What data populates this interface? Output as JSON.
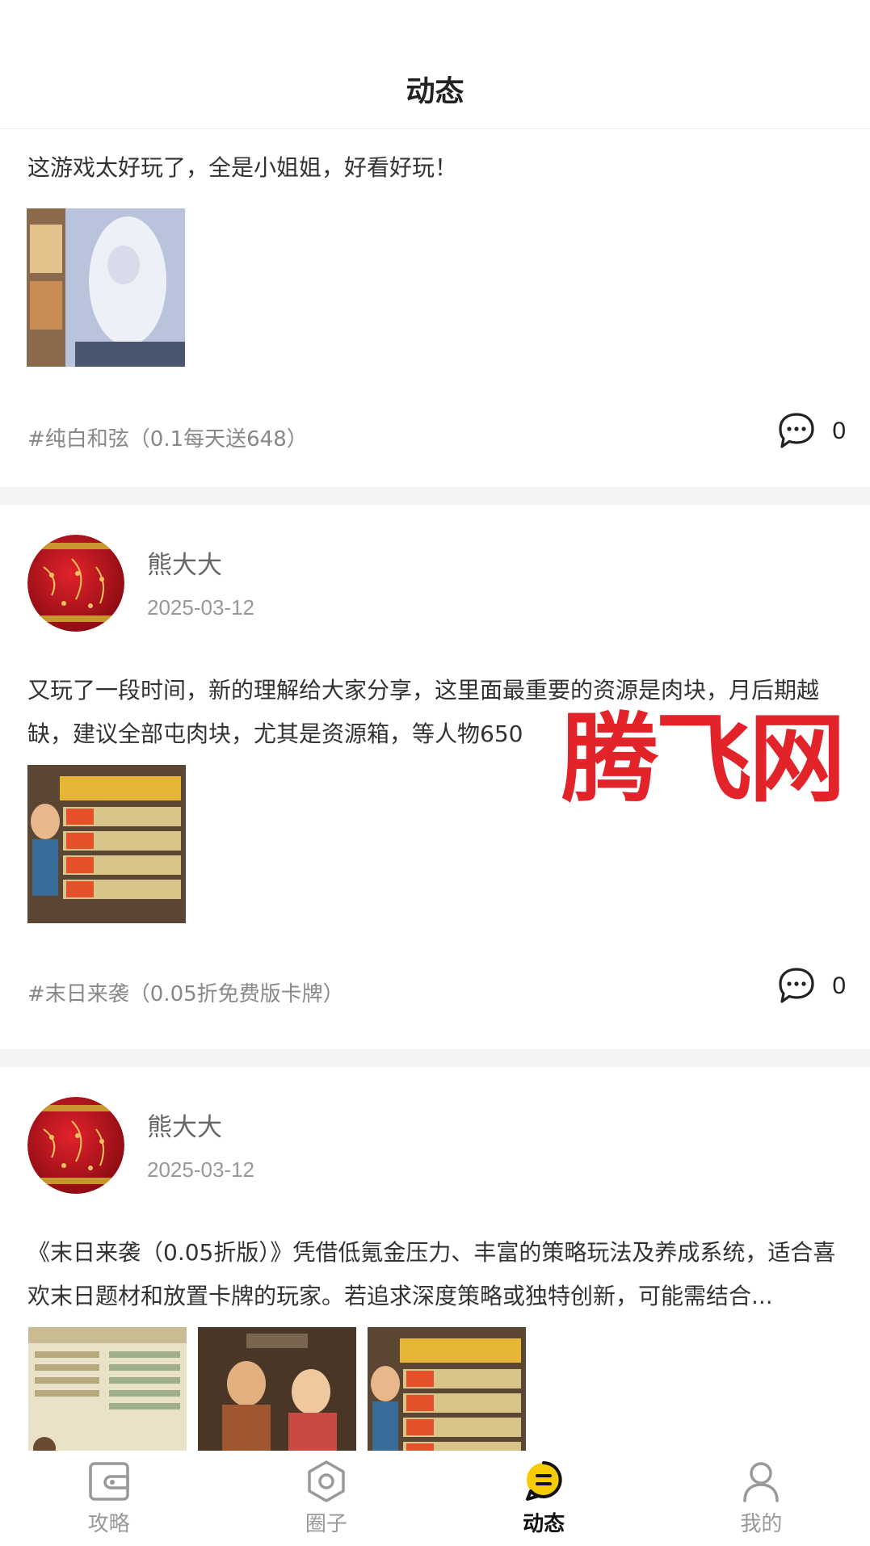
{
  "header": {
    "title": "动态"
  },
  "posts": [
    {
      "content": "这游戏太好玩了，全是小姐姐，好看好玩！",
      "tag": "#纯白和弦（0.1每天送648）",
      "comments": "0"
    },
    {
      "username": "熊大大",
      "date": "2025-03-12",
      "content": "又玩了一段时间，新的理解给大家分享，这里面最重要的资源是肉块，月后期越缺，建议全部屯肉块，尤其是资源箱，等人物650",
      "tag": "#末日来袭（0.05折免费版卡牌）",
      "comments": "0"
    },
    {
      "username": "熊大大",
      "date": "2025-03-12",
      "content": "《末日来袭（0.05折版）》凭借低氪金压力、丰富的策略玩法及养成系统，适合喜欢末日题材和放置卡牌的玩家。若追求深度策略或独特创新，可能需结合..."
    }
  ],
  "watermark": "腾飞网",
  "tabbar": {
    "items": [
      {
        "label": "攻略",
        "icon": "wallet-icon"
      },
      {
        "label": "圈子",
        "icon": "hexagon-icon"
      },
      {
        "label": "动态",
        "icon": "chat-bubble-icon",
        "active": true
      },
      {
        "label": "我的",
        "icon": "user-icon"
      }
    ]
  },
  "colors": {
    "accent": "#f5cc00",
    "watermark": "#e2232a",
    "separator": "#f3f3f3"
  }
}
